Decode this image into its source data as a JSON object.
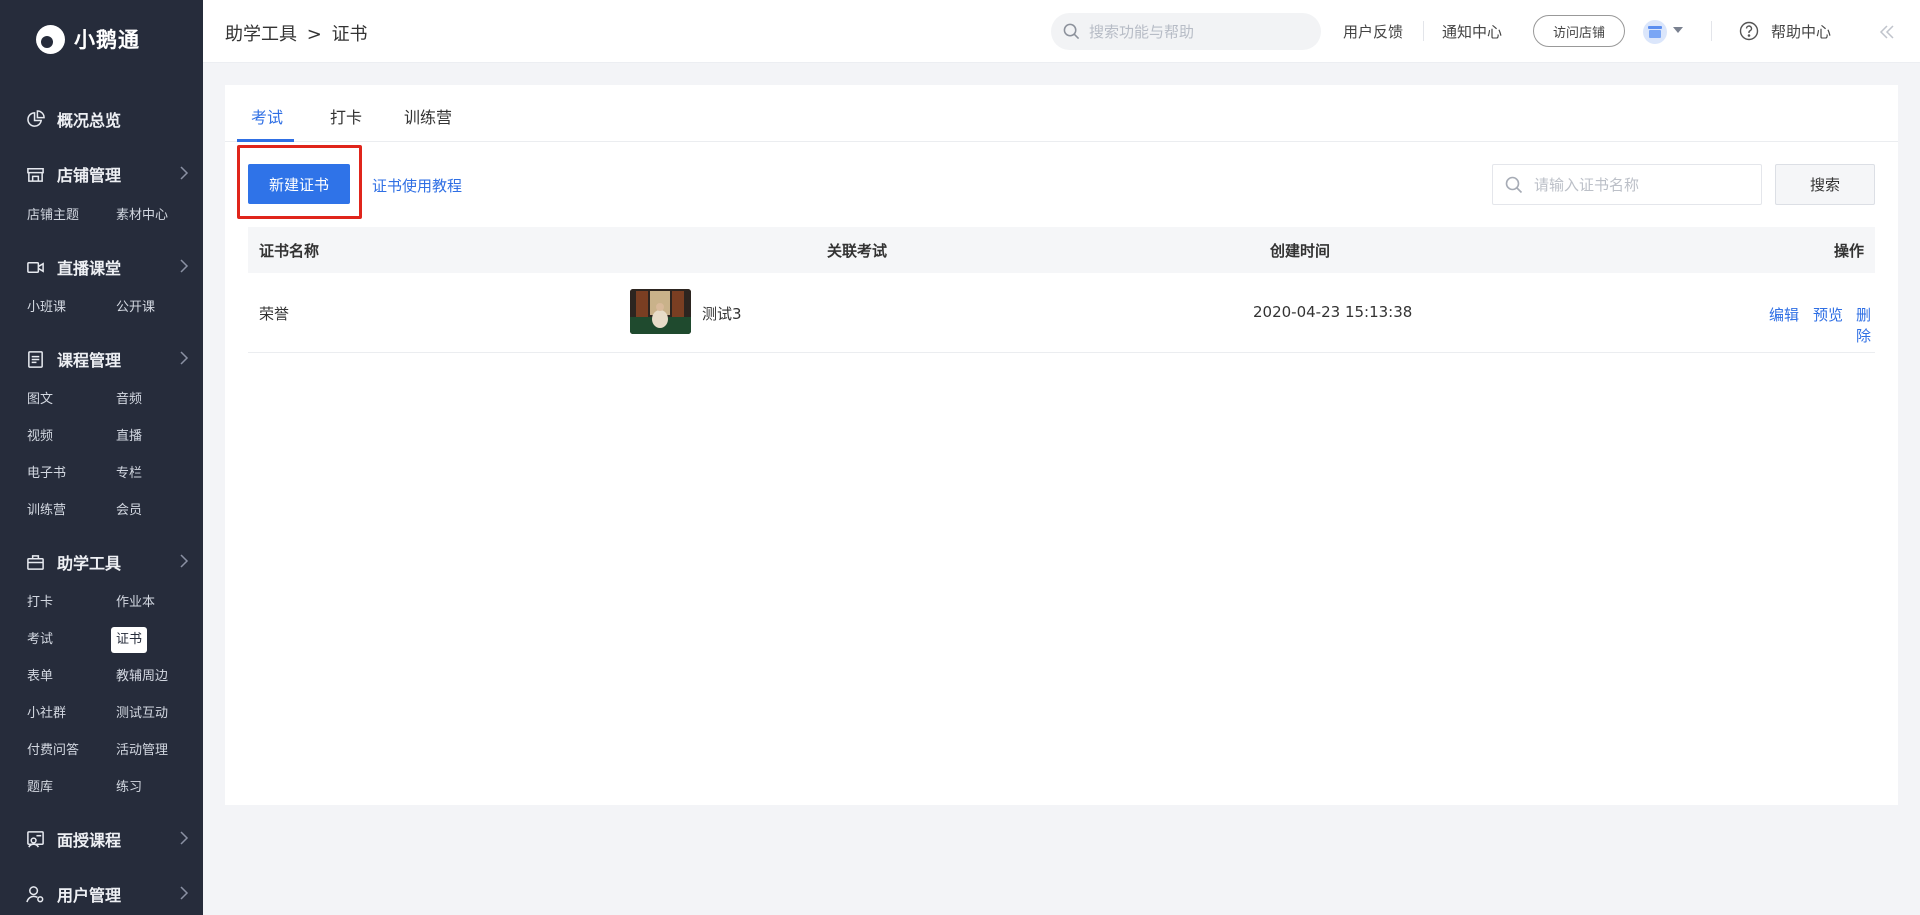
{
  "app": {
    "name": "小鹅通"
  },
  "sidebar": {
    "overview_label": "概况总览",
    "store": {
      "label": "店铺管理",
      "items": [
        "店铺主题",
        "素材中心"
      ]
    },
    "live": {
      "label": "直播课堂",
      "items": [
        "小班课",
        "公开课"
      ]
    },
    "course": {
      "label": "课程管理",
      "items": [
        "图文",
        "音频",
        "视频",
        "直播",
        "电子书",
        "专栏",
        "训练营",
        "会员"
      ]
    },
    "tools": {
      "label": "助学工具",
      "items": [
        "打卡",
        "作业本",
        "考试",
        "证书",
        "表单",
        "教辅周边",
        "小社群",
        "测试互动",
        "付费问答",
        "活动管理",
        "题库",
        "练习"
      ],
      "active": "证书"
    },
    "offline": {
      "label": "面授课程"
    },
    "users": {
      "label": "用户管理"
    }
  },
  "header": {
    "breadcrumb": [
      "助学工具",
      ">",
      "证书"
    ],
    "search_placeholder": "搜索功能与帮助",
    "feedback": "用户反馈",
    "notifications": "通知中心",
    "visit_store": "访问店铺",
    "help_center": "帮助中心"
  },
  "tabs": {
    "items": [
      "考试",
      "打卡",
      "训练营"
    ],
    "active": "考试"
  },
  "toolbar": {
    "new_button": "新建证书",
    "tutorial_link": "证书使用教程",
    "search_placeholder": "请输入证书名称",
    "search_button": "搜索"
  },
  "table": {
    "columns": [
      "证书名称",
      "关联考试",
      "创建时间",
      "操作"
    ],
    "rows": [
      {
        "name": "荣誉",
        "exam": "测试3",
        "created": "2020-04-23 15:13:38",
        "actions": [
          "编辑",
          "预览",
          "删除"
        ]
      }
    ]
  },
  "colors": {
    "sidebar_bg": "#262c3b",
    "accent": "#2f6fe4",
    "highlight": "#e0251b"
  }
}
